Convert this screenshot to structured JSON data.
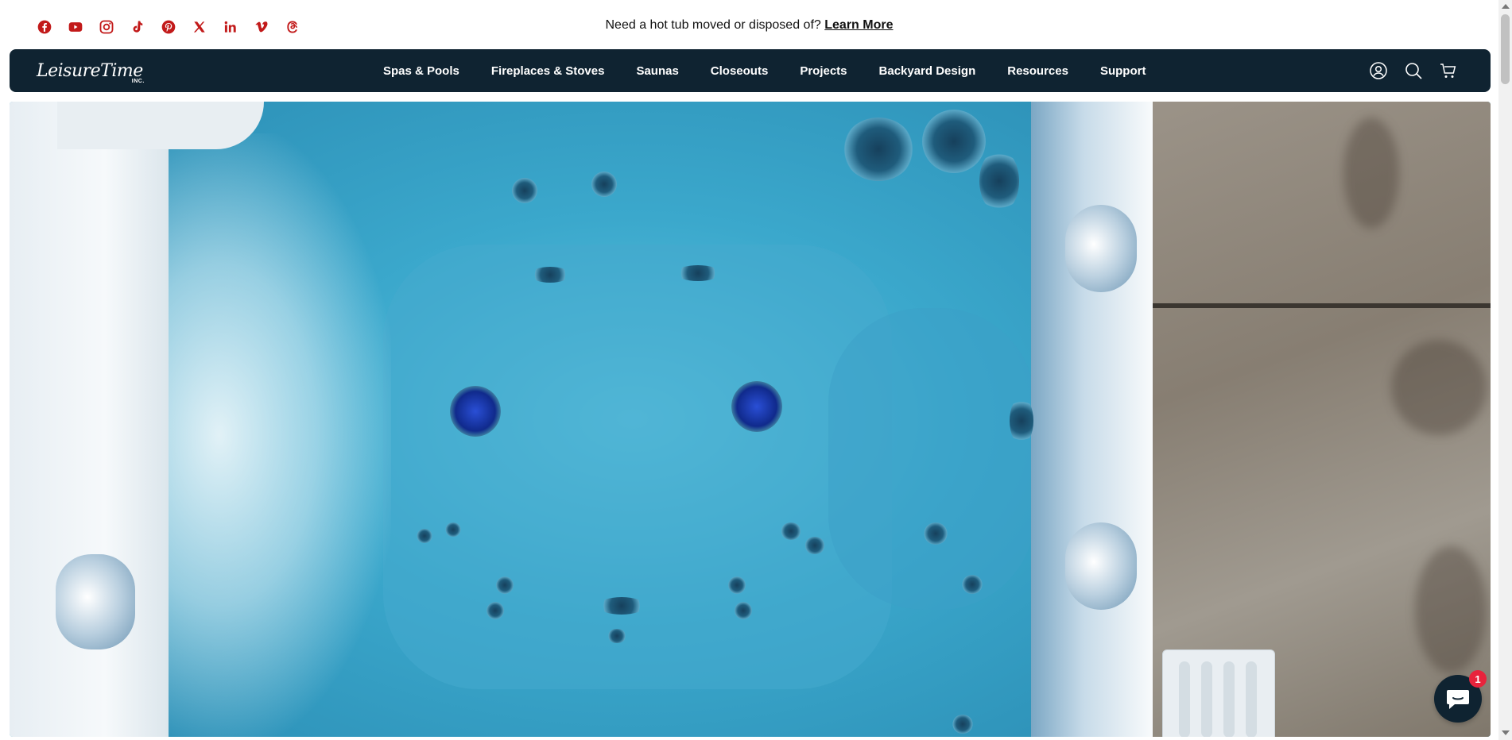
{
  "colors": {
    "brand_dark": "#0f2331",
    "social_red": "#c21a1a",
    "chat_badge": "#e8233c"
  },
  "topbar": {
    "social_icons": [
      "facebook-icon",
      "youtube-icon",
      "instagram-icon",
      "tiktok-icon",
      "pinterest-icon",
      "x-icon",
      "linkedin-icon",
      "vimeo-icon",
      "threads-icon"
    ],
    "announcement_text": "Need a hot tub moved or disposed of?",
    "announcement_link": "Learn More"
  },
  "nav": {
    "logo_text": "LeisureTime",
    "logo_sub": "INC.",
    "items": [
      {
        "label": "Spas & Pools"
      },
      {
        "label": "Fireplaces & Stoves"
      },
      {
        "label": "Saunas"
      },
      {
        "label": "Closeouts"
      },
      {
        "label": "Projects"
      },
      {
        "label": "Backyard Design"
      },
      {
        "label": "Resources"
      },
      {
        "label": "Support"
      }
    ],
    "icons": [
      "account-icon",
      "search-icon",
      "cart-icon"
    ]
  },
  "chat": {
    "badge_count": "1",
    "icon": "chat-icon"
  }
}
